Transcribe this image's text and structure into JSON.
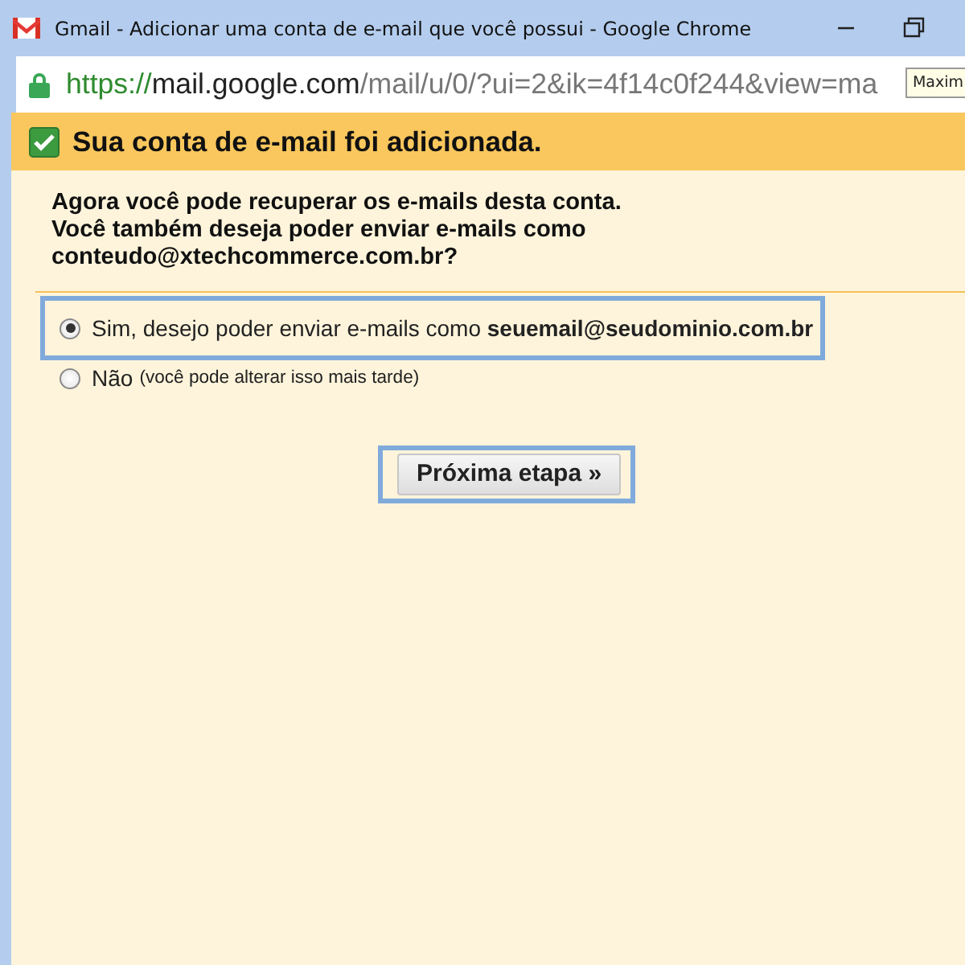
{
  "window": {
    "title": "Gmail - Adicionar uma conta de e-mail que você possui - Google Chrome"
  },
  "address_bar": {
    "scheme": "https://",
    "host": "mail.google.com",
    "path": "/mail/u/0/?ui=2&ik=4f14c0f244&view=ma"
  },
  "tooltip": {
    "text": "Maxim"
  },
  "header": {
    "title": "Sua conta de e-mail foi adicionada."
  },
  "message": [
    "Agora você pode recuperar os e-mails desta conta.",
    "Você também deseja poder enviar e-mails como",
    "conteudo@xtechcommerce.com.br?"
  ],
  "options": [
    {
      "label": "Sim, desejo poder enviar e-mails como **seuemail@seudominio.com.br**",
      "selected": true,
      "highlighted": true
    },
    {
      "label": "Não",
      "note": "(você pode alterar isso mais tarde)",
      "selected": false,
      "highlighted": false
    }
  ],
  "next_button": {
    "label": "Próxima etapa »",
    "highlighted": true
  }
}
